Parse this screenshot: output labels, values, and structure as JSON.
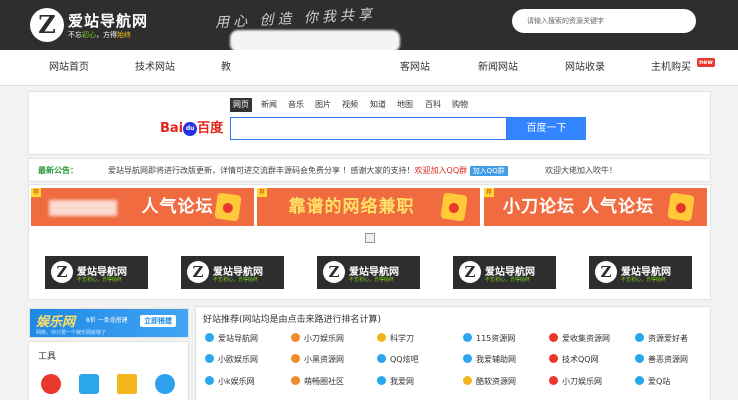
{
  "header": {
    "logo_letter": "Z",
    "site_name": "爱站导航网",
    "slogan_a": "不忘",
    "slogan_b": "初心",
    "slogan_c": "，方得",
    "slogan_d": "始终",
    "handwriting": "用心 创造 你我共享",
    "search_placeholder": "请输入搜索的资源关键字"
  },
  "nav": {
    "items": [
      "网站首页",
      "技术网站",
      "教",
      "",
      "客网站",
      "新闻网站",
      "网站收录",
      "主机购买"
    ],
    "new_badge": "new"
  },
  "baidu": {
    "tabs": [
      "网页",
      "新闻",
      "音乐",
      "图片",
      "视频",
      "知道",
      "地图",
      "百科",
      "购物"
    ],
    "logo_bai": "Bai",
    "logo_paw": "du",
    "logo_du": "百度",
    "button": "百度一下"
  },
  "notice": {
    "label": "最新公告：",
    "text": "爱站导航网即将进行改版更新，详情可进交流群丰源码会免费分享 ！感谢大家的支持！",
    "join": "欢迎加入QQ群",
    "qq_badge": "加入QQ群",
    "text2": "欢迎大佬加入吹牛！"
  },
  "banners": [
    {
      "tag": "荐",
      "text": "人气论坛",
      "color": "#f06b3f"
    },
    {
      "tag": "荐",
      "text": "靠谱的网络兼职",
      "color": "#f06b3f"
    },
    {
      "tag": "荐",
      "text": "小刀论坛  人气论坛",
      "color": "#f06b3f"
    }
  ],
  "tiles": {
    "letter": "Z",
    "name": "爱站导航网",
    "slogan": "不忘初心，方得始终",
    "count": 5
  },
  "left": {
    "ad_title": "娱乐网",
    "ad_sub": "8折 一条龙搭建",
    "ad_sub2": "网络，你只要一个娱乐网就够了",
    "ad_button": "立即搭建",
    "tools_title": "工具",
    "tools": [
      {
        "icon": "red-tool-icon",
        "color": "#e8382d"
      },
      {
        "icon": "z-tool-icon",
        "color": "#2aa7e8"
      },
      {
        "icon": "qrcode-tool-icon",
        "color": "#f2b61c"
      },
      {
        "icon": "shield-tool-icon",
        "color": "#2f9ff0"
      }
    ]
  },
  "friends": {
    "title": "好站推荐(网站均是由点击来路进行排名计算)",
    "rows": [
      [
        {
          "label": "爱站导航网",
          "color": "#2aa7e8"
        },
        {
          "label": "小刀娱乐网",
          "color": "#f08a2a"
        },
        {
          "label": "科学刀",
          "color": "#f2b61c"
        },
        {
          "label": "115资源网",
          "color": "#2aa7e8"
        },
        {
          "label": "爱收集资源网",
          "color": "#e8382d"
        },
        {
          "label": "资源爱好者",
          "color": "#2aa7e8"
        }
      ],
      [
        {
          "label": "小欧娱乐网",
          "color": "#2aa7e8"
        },
        {
          "label": "小黑资源网",
          "color": "#f08a2a"
        },
        {
          "label": "QQ炫吧",
          "color": "#2aa7e8"
        },
        {
          "label": "我爱辅助网",
          "color": "#2aa7e8"
        },
        {
          "label": "技术QQ网",
          "color": "#e8382d"
        },
        {
          "label": "善恶资源网",
          "color": "#2aa7e8"
        }
      ],
      [
        {
          "label": "小k娱乐网",
          "color": "#2aa7e8"
        },
        {
          "label": "萌畅圈社区",
          "color": "#f08a2a"
        },
        {
          "label": "我爱网",
          "color": "#2aa7e8"
        },
        {
          "label": "酷软资源网",
          "color": "#f2b61c"
        },
        {
          "label": "小刀娱乐网",
          "color": "#e8382d"
        },
        {
          "label": "爱Q站",
          "color": "#2aa7e8"
        }
      ]
    ]
  }
}
